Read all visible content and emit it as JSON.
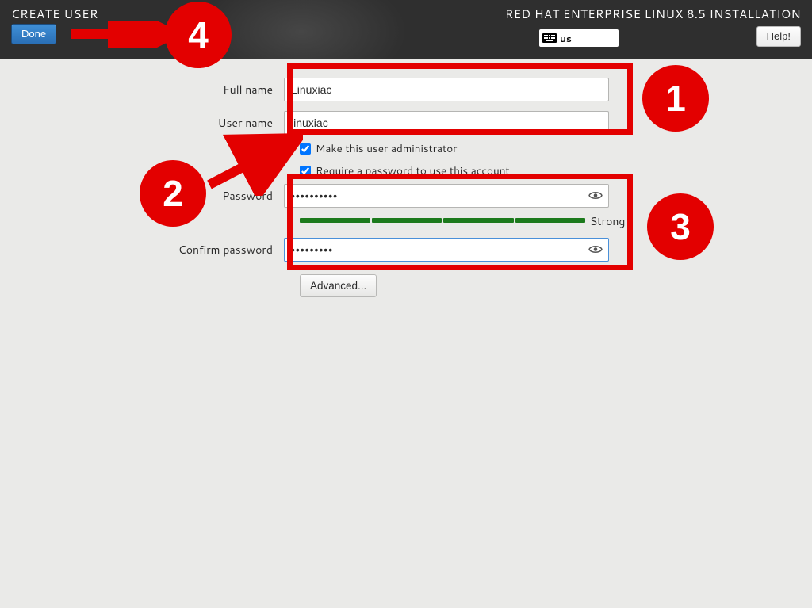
{
  "header": {
    "title": "CREATE USER",
    "done": "Done",
    "product": "RED HAT ENTERPRISE LINUX 8.5 INSTALLATION",
    "keyboard": "us",
    "help": "Help!"
  },
  "form": {
    "full_name_label": "Full name",
    "full_name_value": "Linuxiac",
    "user_name_label": "User name",
    "user_name_value": "linuxiac",
    "make_admin_label": "Make this user administrator",
    "make_admin_checked": true,
    "require_pw_label": "Require a password to use this account",
    "require_pw_checked": true,
    "password_label": "Password",
    "password_value": "••••••••••",
    "confirm_label": "Confirm password",
    "confirm_value": "•••••••••",
    "strength_label": "Strong",
    "advanced": "Advanced..."
  },
  "annotations": {
    "n1": "1",
    "n2": "2",
    "n3": "3",
    "n4": "4"
  }
}
